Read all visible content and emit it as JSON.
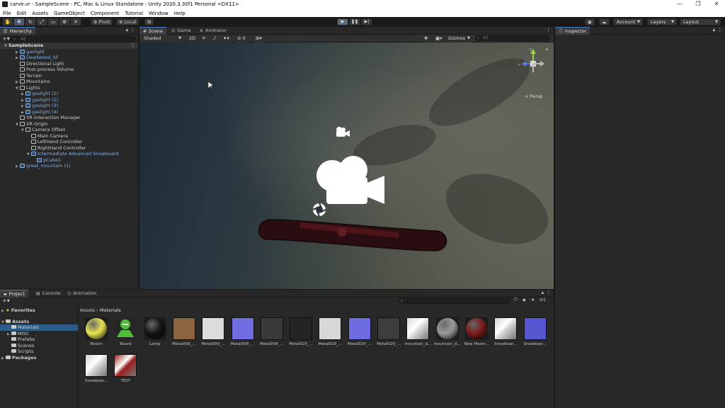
{
  "window": {
    "title": "carve.vr - SampleScene - PC, Mac & Linux Standalone - Unity 2020.3.30f1 Personal <DX11>",
    "minimize": "—",
    "maximize": "❐",
    "close": "✕"
  },
  "menu": [
    "File",
    "Edit",
    "Assets",
    "GameObject",
    "Component",
    "Tutorial",
    "Window",
    "Help"
  ],
  "toolbar": {
    "pivot": "Pivot",
    "local": "Local",
    "account": "Account",
    "layers": "Layers",
    "layout": "Layout",
    "play_icon": "play-icon",
    "pause_icon": "pause-icon",
    "step_icon": "step-icon"
  },
  "hierarchy": {
    "tab": "Hierarchy",
    "search_placeholder": "All",
    "items": [
      {
        "label": "SampleScene",
        "depth": 0,
        "kind": "scene",
        "expanded": true
      },
      {
        "label": "gaslight",
        "depth": 1,
        "kind": "prefab",
        "expanded": false
      },
      {
        "label": "Deadwood_SF",
        "depth": 1,
        "kind": "prefab",
        "expanded": false
      },
      {
        "label": "Directional Light",
        "depth": 1,
        "kind": "object"
      },
      {
        "label": "Post-process Volume",
        "depth": 1,
        "kind": "object"
      },
      {
        "label": "Terrain",
        "depth": 1,
        "kind": "object"
      },
      {
        "label": "Mountains",
        "depth": 1,
        "kind": "object",
        "expanded": false
      },
      {
        "label": "Lights",
        "depth": 1,
        "kind": "object",
        "expanded": true
      },
      {
        "label": "gaslight (1)",
        "depth": 2,
        "kind": "prefab",
        "expanded": false
      },
      {
        "label": "gaslight (2)",
        "depth": 2,
        "kind": "prefab",
        "expanded": false
      },
      {
        "label": "gaslight (3)",
        "depth": 2,
        "kind": "prefab",
        "expanded": false
      },
      {
        "label": "gaslight (4)",
        "depth": 2,
        "kind": "prefab",
        "expanded": false
      },
      {
        "label": "XR Interaction Manager",
        "depth": 1,
        "kind": "object"
      },
      {
        "label": "XR Origin",
        "depth": 1,
        "kind": "object",
        "expanded": true
      },
      {
        "label": "Camera Offset",
        "depth": 2,
        "kind": "object",
        "expanded": true
      },
      {
        "label": "Main Camera",
        "depth": 3,
        "kind": "object"
      },
      {
        "label": "LeftHand Controller",
        "depth": 3,
        "kind": "object"
      },
      {
        "label": "RightHand Controller",
        "depth": 3,
        "kind": "object"
      },
      {
        "label": "Intermediate Advanced Snowboard",
        "depth": 3,
        "kind": "prefab",
        "expanded": true
      },
      {
        "label": "pCube1",
        "depth": 4,
        "kind": "prefab"
      },
      {
        "label": "great_mountain (1)",
        "depth": 1,
        "kind": "prefab",
        "expanded": false
      }
    ]
  },
  "scene_view": {
    "tabs": [
      {
        "label": "Scene",
        "icon": "grid-icon",
        "active": true
      },
      {
        "label": "Game",
        "icon": "gamepad-icon",
        "active": false
      },
      {
        "label": "Animator",
        "icon": "animator-icon",
        "active": false
      }
    ],
    "shading": "Shaded",
    "mode_2d": "2D",
    "gizmos": "Gizmos",
    "search_placeholder": "All",
    "layer_count": "0",
    "persp": "< Persp",
    "axes": {
      "y": "y",
      "z": "z"
    }
  },
  "inspector": {
    "tab": "Inspector"
  },
  "project": {
    "tabs": [
      {
        "label": "Project",
        "active": true
      },
      {
        "label": "Console",
        "active": false
      },
      {
        "label": "Animation",
        "active": false
      }
    ],
    "badge": "1",
    "tree": [
      {
        "label": "Favorites",
        "depth": 0,
        "icon": "star-icon",
        "expanded": false
      },
      {
        "label": "Assets",
        "depth": 0,
        "icon": "folder-icon",
        "expanded": true
      },
      {
        "label": "Materials",
        "depth": 1,
        "icon": "folder-icon",
        "selected": true
      },
      {
        "label": "MISC",
        "depth": 1,
        "icon": "folder-icon",
        "expanded": false
      },
      {
        "label": "Prefabs",
        "depth": 1,
        "icon": "folder-icon"
      },
      {
        "label": "Scenes",
        "depth": 1,
        "icon": "folder-icon"
      },
      {
        "label": "Scripts",
        "depth": 1,
        "icon": "folder-icon"
      },
      {
        "label": "Packages",
        "depth": 0,
        "icon": "folder-icon",
        "expanded": false
      }
    ],
    "breadcrumb": [
      "Assets",
      "Materials"
    ],
    "assets": [
      {
        "label": "Bloom",
        "swatch": "#e9e352",
        "style": "sphere"
      },
      {
        "label": "Board",
        "swatch": "#4fbf3a",
        "style": "icon"
      },
      {
        "label": "Lamp",
        "swatch": "#141414",
        "style": "sphere"
      },
      {
        "label": "Metal008_...",
        "swatch": "#8a6540",
        "style": "flat"
      },
      {
        "label": "Metal009_...",
        "swatch": "#dcdcdc",
        "style": "flat"
      },
      {
        "label": "Metal008_...",
        "swatch": "#6f6de0",
        "style": "flat"
      },
      {
        "label": "Metal008_...",
        "swatch": "#3a3a3a",
        "style": "flat"
      },
      {
        "label": "Metal029_...",
        "swatch": "#232523",
        "style": "flat"
      },
      {
        "label": "Metal029_...",
        "swatch": "#d8d8d8",
        "style": "flat"
      },
      {
        "label": "Metal029_...",
        "swatch": "#6d6de0",
        "style": "flat"
      },
      {
        "label": "Metal029_...",
        "swatch": "#3c3c3c",
        "style": "flat"
      },
      {
        "label": "mountain_d...",
        "swatch": "#d8d8d8",
        "style": "tex"
      },
      {
        "label": "mountain_d...",
        "swatch": "#9a9a9a",
        "style": "sphere"
      },
      {
        "label": "New Mater...",
        "swatch": "#7a1c1c",
        "style": "sphere"
      },
      {
        "label": "Snowboar...",
        "swatch": "#cfcfcf",
        "style": "tex"
      },
      {
        "label": "Snowboar...",
        "swatch": "#5656d0",
        "style": "flat"
      },
      {
        "label": "Snowboar...",
        "swatch": "#d2d2d2",
        "style": "tex"
      },
      {
        "label": "TEST",
        "swatch": "#9a1f1f",
        "style": "tex"
      }
    ]
  },
  "colors": {
    "accent": "#4a78c8",
    "selection": "#2c5d87",
    "prefab_text": "#7fb1e6",
    "panel": "#282828",
    "toolbar": "#191919"
  }
}
